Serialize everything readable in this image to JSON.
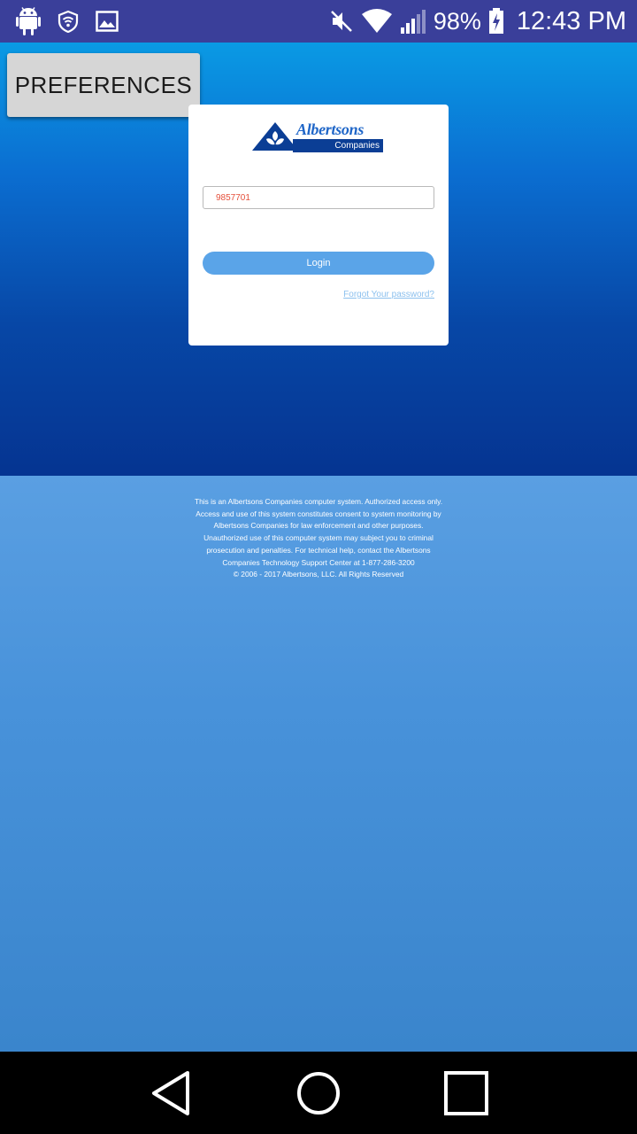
{
  "status_bar": {
    "battery": "98%",
    "time": "12:43 PM",
    "icons_left": [
      "android-icon",
      "shield-wifi-icon",
      "image-icon"
    ],
    "icons_right": [
      "mute-icon",
      "wifi-icon",
      "signal-icon",
      "battery-charging-icon"
    ]
  },
  "preferences_button": {
    "label": "PREFERENCES"
  },
  "login": {
    "logo": {
      "name": "Albertsons",
      "sub": "Companies"
    },
    "username_value": "9857701",
    "login_label": "Login",
    "forgot_label": "Forgot Your password?"
  },
  "disclaimer": {
    "text": "This is an Albertsons Companies computer system. Authorized access only. Access and use of this system constitutes consent to system monitoring by Albertsons Companies for law enforcement and other purposes. Unauthorized use of this computer system may subject you to criminal prosecution and penalties. For technical help, contact the Albertsons Companies Technology Support Center at 1-877-286-3200",
    "copyright": "© 2006 - 2017 Albertsons, LLC. All Rights Reserved"
  },
  "nav_bar": {
    "buttons": [
      "back-icon",
      "home-icon",
      "recents-icon"
    ]
  },
  "colors": {
    "status_bar": "#3a3f9a",
    "hero_top": "#0a9ae4",
    "hero_bottom": "#053491",
    "lower_bg": "#4892da",
    "login_button": "#5aa4e8",
    "logo_blue": "#0b3e95",
    "input_text": "#e5503b"
  }
}
